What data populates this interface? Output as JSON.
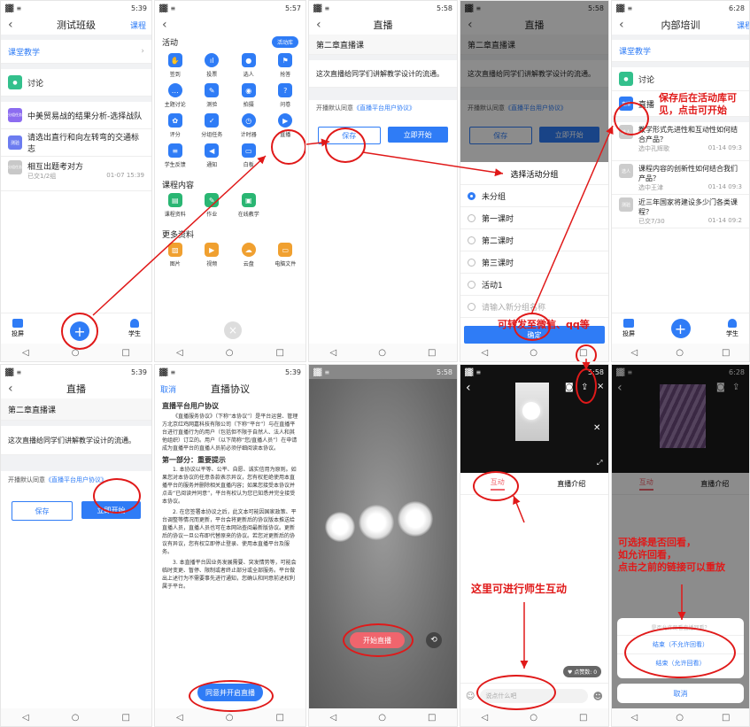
{
  "status_time": [
    "5:39",
    "5:57",
    "5:58",
    "5:58",
    "6:28"
  ],
  "status_signal": "▓▓ ≡",
  "p1": {
    "title": "测试班级",
    "right": "课程",
    "section": "课堂教学",
    "items": [
      {
        "icon": "讨论",
        "label": "讨论"
      },
      {
        "icon": "分组任务",
        "label": "中美贸易战的结果分析-选择战队"
      },
      {
        "icon": "测验",
        "label": "请选出直行和向左转弯的交通标志"
      },
      {
        "icon": "分组任务",
        "label": "相互出题考对方",
        "sub": "已交1/2组",
        "date": "01-07 15:39"
      }
    ],
    "bottom": {
      "left": "投屏",
      "right": "学生"
    }
  },
  "p2": {
    "activity": "活动",
    "library": "活动库",
    "grid": [
      "签到",
      "投票",
      "选人",
      "抢答",
      "主题讨论",
      "测验",
      "拍摄",
      "问卷",
      "评分",
      "分组任务",
      "计时器",
      "直播",
      "学生反馈",
      "通知",
      "白板"
    ],
    "course_content": "课程内容",
    "cc_items": [
      "课程资料",
      "作业",
      "在线教学"
    ],
    "more": "更多资料",
    "more_items": [
      "图片",
      "视频",
      "云盘",
      "电脑文件"
    ]
  },
  "p3": {
    "title": "直播",
    "name": "第二章直播课",
    "desc": "这次直播给同学们讲解教学设计的流通。",
    "agree_prefix": "开播默认同意",
    "agree_link": "《直播平台用户协议》",
    "save": "保存",
    "start": "立即开始"
  },
  "p4": {
    "sheet_title": "选择活动分组",
    "options": [
      "未分组",
      "第一课时",
      "第二课时",
      "第三课时",
      "活动1"
    ],
    "add_placeholder": "请输入新分组名称",
    "confirm": "确定"
  },
  "p5": {
    "title": "内部培训",
    "right": "课程",
    "section": "课堂教学",
    "items": [
      {
        "icon": "讨论",
        "label": "讨论"
      },
      {
        "icon": "直播",
        "label": "直播"
      },
      {
        "icon": "选人",
        "label": "教学形式先进性和互动性如何结合产品？",
        "sub": "选中孔辉歌",
        "date": "01-14 09:3"
      },
      {
        "icon": "选人",
        "label": "课程内容的创新性如何结合我们产品？",
        "sub": "选中王津",
        "date": "01-14 09:3"
      },
      {
        "icon": "测验",
        "label": "近三年国家将建设多少门各类课程？",
        "sub": "已交7/30",
        "date": "01-14 09:2"
      }
    ],
    "bottom": {
      "left": "投屏",
      "right": "学生"
    }
  },
  "p6": {
    "title": "直播",
    "name": "第二章直播课",
    "desc": "这次直播给同学们讲解教学设计的流通。",
    "agree_prefix": "开播默认同意",
    "agree_link": "《直播平台用户协议》",
    "save": "保存",
    "start": "立即开始"
  },
  "p7": {
    "cancel": "取消",
    "title": "直播协议",
    "doc_title": "直播平台用户协议",
    "para1": "《直播服务协议》（下称“本协议”）是平台运营、管理方北京红鸡网嘉科技有限公司（下称“平台”）与在直播平台进行直播行为的用户（包括但不限于自然人、法人和其他组织）订立的。用户（以下简称“您/直播人员”）在申请成为直播平台的直播人员前必须仔细阅读本协议。",
    "part1": "第一部分：重要提示",
    "para2": "1. 本协议以平等、公平、自愿、诚实信用为原则。如果您对本协议的任意条款表示异议，您有权拒绝使用本直播平台的服务并删除相关直播内容；如果您接受本协议并点击“已阅读并同意”，平台有权认为您已知悉并完全接受本协议。",
    "para3": "2. 在您签署本协议之后，此文本可能因国家政策、平台调整等情况而更新，平台会将更新后的协议版本推送给直播人员，直播人员也可在本网站查阅最新版协议。更新后的协议一旦公布即代替原来的协议。若您对更新后的协议有异议，您有权立即停止登录、使用本直播平台及服务。",
    "para4": "3. 本直播平台因业务发展需要、突发情势等，可能会临时变更、暂停、限制或者终止部分或全部服务。平台做出上述行为不需要事先进行通知，您确认和同意前述权利属于平台。",
    "agree_btn": "同意并开启直播"
  },
  "p8": {
    "start_live": "开始直播"
  },
  "p9": {
    "tab_interact": "互动",
    "tab_intro": "直播介绍",
    "like": "点赞数: 0",
    "chat_placeholder": "说点什么吧"
  },
  "p10": {
    "tab_interact": "互动",
    "tab_intro": "直播介绍",
    "dialog_title": "是否允许观看直播回看？",
    "end_no": "结束（不允许回看）",
    "end_yes": "结束（允许回看）",
    "cancel": "取消"
  },
  "annotations": {
    "a1": "保存后在活动库可见，点击可开始",
    "a2": "可转发至微信、qq等",
    "a3": "这里可进行师生互动",
    "a4": "可选择是否回看，\n如允许回看，\n点击之前的链接可以重放"
  },
  "colors": {
    "accent": "#2f7cf6",
    "annotation": "#e01919",
    "live_btn": "#f0656d"
  }
}
